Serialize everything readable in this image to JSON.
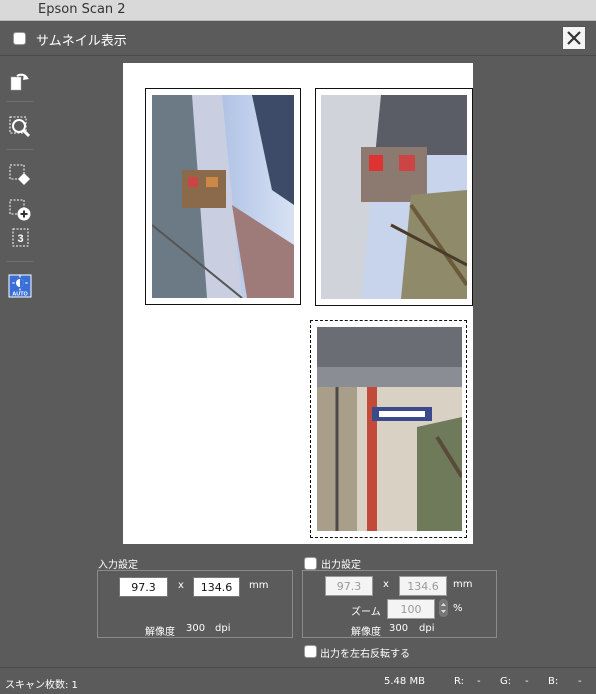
{
  "window": {
    "title": "Epson Scan 2"
  },
  "toolbar": {
    "thumbnail_label": "サムネイル表示",
    "thumbnail_checked": false
  },
  "left_tools": [
    {
      "icon": "rotate-icon"
    },
    {
      "icon": "zoom-icon"
    },
    {
      "icon": "erase-selection-icon"
    },
    {
      "icon": "add-selection-icon"
    },
    {
      "icon": "copy-count-icon",
      "text": "3"
    },
    {
      "icon": "auto-exposure-icon",
      "text": "AUTO"
    }
  ],
  "input_settings": {
    "label": "入力設定",
    "width": "97.3",
    "x": "x",
    "height": "134.6",
    "unit": "mm",
    "resolution_label": "解像度",
    "resolution": "300",
    "resolution_unit": "dpi"
  },
  "output_settings": {
    "label": "出力設定",
    "checked": false,
    "width": "97.3",
    "x": "x",
    "height": "134.6",
    "unit": "mm",
    "zoom_label": "ズーム",
    "zoom": "100",
    "zoom_unit": "%",
    "resolution_label": "解像度",
    "resolution": "300",
    "resolution_unit": "dpi"
  },
  "flip": {
    "label": "出力を左右反転する",
    "checked": false
  },
  "status": {
    "scan_count": "スキャン枚数: 1",
    "size": "5.48 MB",
    "r_label": "R:",
    "r_value": "-",
    "g_label": "G:",
    "g_value": "-",
    "b_label": "B:",
    "b_value": "-"
  }
}
